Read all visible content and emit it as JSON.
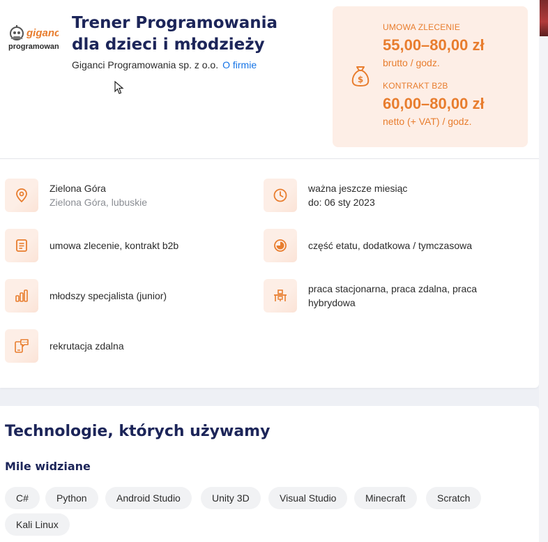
{
  "logo": {
    "line1": "giganci",
    "line2": "programowania"
  },
  "job": {
    "title": "Trener Programowania dla dzieci i młodzieży",
    "company": "Giganci Programowania sp. z o.o.",
    "about_link": "O firmie"
  },
  "salary": {
    "icon": "money-bag-icon",
    "items": [
      {
        "type": "UMOWA ZLECENIE",
        "amount": "55,00–80,00 zł",
        "unit": "brutto / godz."
      },
      {
        "type": "KONTRAKT B2B",
        "amount": "60,00–80,00 zł",
        "unit": "netto (+ VAT) / godz."
      }
    ]
  },
  "details": {
    "location": {
      "main": "Zielona Góra",
      "sub": "Zielona Góra, lubuskie",
      "icon": "location-pin-icon"
    },
    "validity": {
      "main": "ważna jeszcze miesiąc",
      "sub": "do: 06 sty 2023",
      "icon": "clock-icon"
    },
    "contract": {
      "main": "umowa zlecenie, kontrakt b2b",
      "icon": "document-icon"
    },
    "worktime": {
      "main": "część etatu, dodatkowa / tymczasowa",
      "icon": "pie-chart-icon"
    },
    "level": {
      "main": "młodszy specjalista (junior)",
      "icon": "bar-chart-icon"
    },
    "mode": {
      "main": "praca stacjonarna, praca zdalna, praca hybrydowa",
      "icon": "desk-icon"
    },
    "recruitment": {
      "main": "rekrutacja zdalna",
      "icon": "remote-chat-icon"
    }
  },
  "technologies": {
    "heading": "Technologie, których używamy",
    "subheading": "Mile widziane",
    "chips": [
      "C#",
      "Python",
      "Android Studio",
      "Unity 3D",
      "Visual Studio",
      "Minecraft",
      "Scratch",
      "Kali Linux"
    ]
  },
  "colors": {
    "accent": "#e87d2e",
    "title": "#1c2559",
    "link": "#1473e6",
    "salary_bg": "#fdeee6"
  }
}
